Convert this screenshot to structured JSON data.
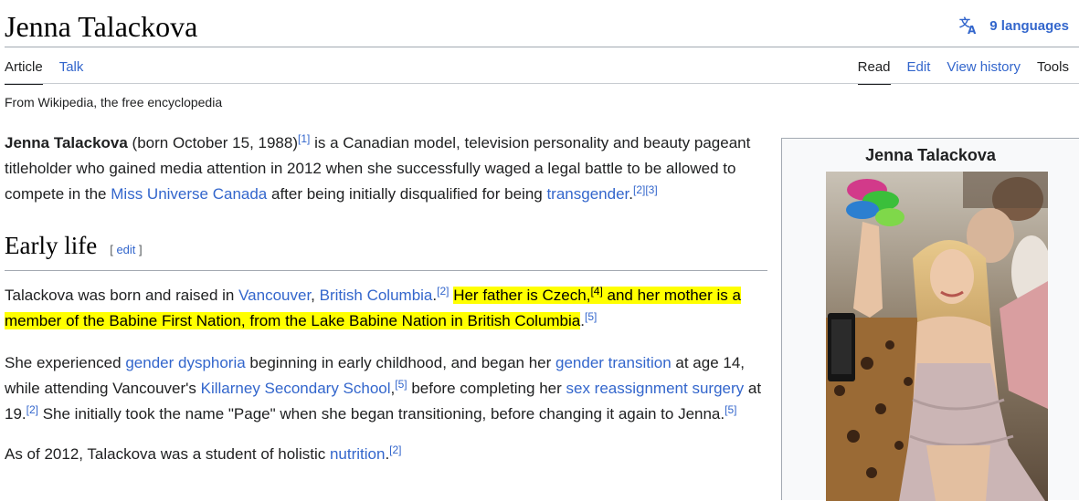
{
  "header": {
    "title": "Jenna Talackova",
    "languages_label": "9 languages"
  },
  "tabs": {
    "article": "Article",
    "talk": "Talk",
    "read": "Read",
    "edit": "Edit",
    "view_history": "View history",
    "tools": "Tools"
  },
  "tagline": "From Wikipedia, the free encyclopedia",
  "intro": {
    "bold_name": "Jenna Talackova",
    "t1": " (born October 15, 1988)",
    "ref1": "[1]",
    "t2": " is a Canadian model, television personality and beauty pageant titleholder who gained media attention in 2012 when she successfully waged a legal battle to be allowed to compete in the ",
    "link_miss_universe": "Miss Universe Canada",
    "t3": " after being initially disqualified for being ",
    "link_transgender": "transgender",
    "t4": ".",
    "ref2": "[2]",
    "ref3": "[3]"
  },
  "section": {
    "heading": "Early life",
    "edit_open": "[ ",
    "edit_label": "edit",
    "edit_close": " ]"
  },
  "para1": {
    "t1": "Talackova was born and raised in ",
    "link_vancouver": "Vancouver",
    "comma": ", ",
    "link_bc": "British Columbia",
    "t2": ".",
    "ref2": "[2]",
    "space": " ",
    "hl1": "Her father is Czech,",
    "ref4": "[4]",
    "hl2": " and her mother is a member of the Babine First Nation, from the Lake Babine Nation in British Columbia",
    "t3": ".",
    "ref5": "[5]"
  },
  "para2": {
    "t1": "She experienced ",
    "link_dysphoria": "gender dysphoria",
    "t2": " beginning in early childhood, and began her ",
    "link_transition": "gender transition",
    "t3": " at age 14, while attending Vancouver's ",
    "link_school": "Killarney Secondary School",
    "t4": ",",
    "ref5a": "[5]",
    "t5": " before completing her ",
    "link_srs": "sex reassignment surgery",
    "t6": " at 19.",
    "ref2": "[2]",
    "t7": " She initially took the name \"Page\" when she began transitioning, before changing it again to Jenna.",
    "ref5b": "[5]"
  },
  "para3": {
    "t1": "As of 2012, Talackova was a student of holistic ",
    "link_nutrition": "nutrition",
    "t2": ".",
    "ref2": "[2]"
  },
  "infobox": {
    "title": "Jenna Talackova"
  },
  "colors": {
    "link": "#3366cc",
    "highlight": "#ffff00",
    "text": "#202122"
  }
}
